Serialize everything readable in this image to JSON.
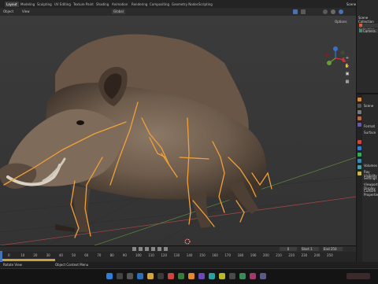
{
  "workspace_tabs": [
    "Layout",
    "Modeling",
    "Sculpting",
    "UV Editing",
    "Texture Paint",
    "Shading",
    "Animation",
    "Rendering",
    "Compositing",
    "Geometry Nodes",
    "Scripting"
  ],
  "active_tab": "Layout",
  "scene_label": "Scene",
  "view_layer_label": "ViewLayer",
  "toolbar": {
    "mode": "Object",
    "menu_view": "View",
    "menu_select": "Select",
    "menu_add": "Add",
    "menu_object": "Object",
    "transform": "Global",
    "options": "Options"
  },
  "outliner": {
    "header": "Scene Collection",
    "items": [
      "Scene Collection",
      "Collection",
      "Camera"
    ]
  },
  "properties": {
    "scene": "Scene",
    "panels": [
      "Format",
      "Surface",
      "Volumes",
      "Ray Visibility",
      "Settings",
      "Viewport Display",
      "Custom Properties"
    ]
  },
  "timeline": {
    "frames": [
      "0",
      "10",
      "20",
      "30",
      "40",
      "50",
      "60",
      "70",
      "80",
      "90",
      "100",
      "110",
      "120",
      "130",
      "140",
      "150",
      "160",
      "170",
      "180",
      "190",
      "200",
      "210",
      "220",
      "230",
      "240",
      "250"
    ],
    "current_frame": "0",
    "start_label": "Start",
    "start_value": "1",
    "end_label": "End",
    "end_value": "250"
  },
  "status": {
    "left": "Rotate View",
    "right": "Object Context Menu"
  },
  "colors": {
    "accent": "#4772b3",
    "bones": "#f0a03a",
    "grid_red": "#a84848",
    "grid_green": "#5c8a3c",
    "viewport_bg": "#393939"
  }
}
